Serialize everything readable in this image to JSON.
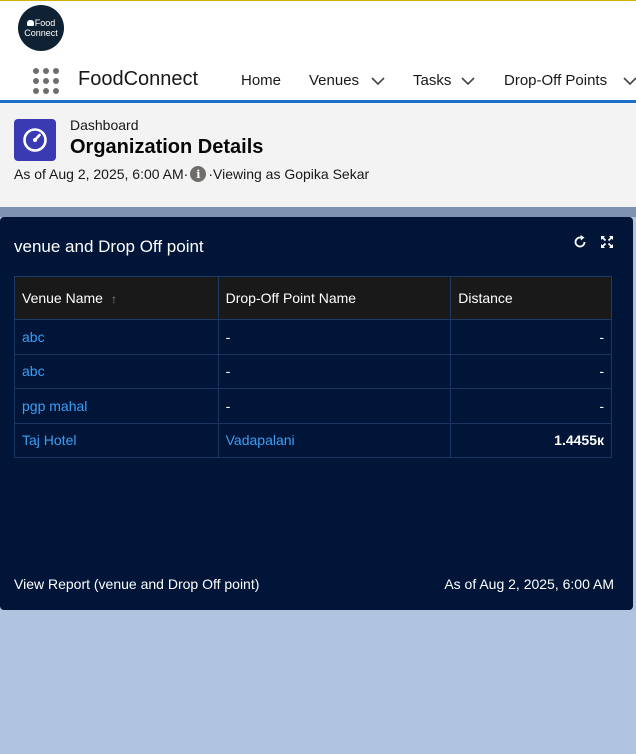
{
  "app": {
    "logo_line1": "Food",
    "logo_line2": "Connect",
    "name": "FoodConnect"
  },
  "nav": {
    "home": "Home",
    "venues": "Venues",
    "tasks": "Tasks",
    "dropoff": "Drop-Off Points"
  },
  "page": {
    "breadcrumb": "Dashboard",
    "title": "Organization Details",
    "as_of": "As of Aug 2, 2025, 6:00 AM·",
    "viewing": "·Viewing as Gopika Sekar"
  },
  "widget": {
    "title": "venue and Drop Off point",
    "columns": [
      "Venue Name",
      "Drop-Off Point Name",
      "Distance"
    ],
    "sort_indicator": "↑",
    "rows": [
      {
        "venue": "abc",
        "dropoff": "-",
        "distance": "-"
      },
      {
        "venue": "abc",
        "dropoff": "-",
        "distance": "-"
      },
      {
        "venue": "pgp mahal",
        "dropoff": "-",
        "distance": "-"
      },
      {
        "venue": "Taj Hotel",
        "dropoff": "Vadapalani",
        "distance": "1.4455к"
      }
    ],
    "footer_link": "View Report (venue and Drop Off point)",
    "footer_timestamp": "As of Aug 2, 2025, 6:00 AM"
  },
  "colors": {
    "accent": "#1b6fc9",
    "card_bg": "#001538",
    "link": "#3b9ef5",
    "page_bg": "#b0c4df"
  }
}
